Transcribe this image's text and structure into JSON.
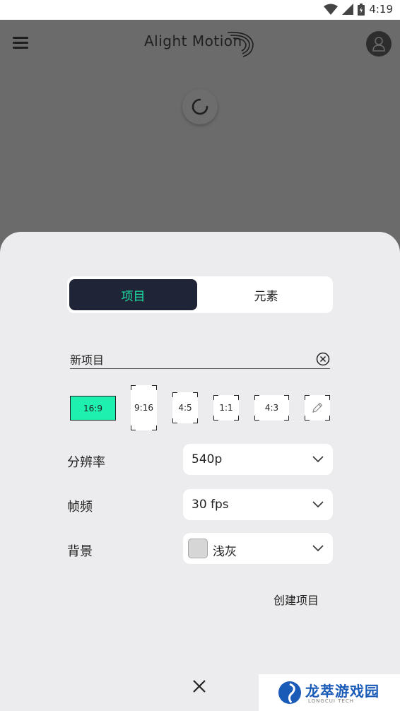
{
  "status_bar": {
    "time": "4:19"
  },
  "app_bar": {
    "logo_text": "Alight Motion"
  },
  "tabs": [
    {
      "label": "项目",
      "active": true
    },
    {
      "label": "元素",
      "active": false
    }
  ],
  "project_name": {
    "value": "新项目"
  },
  "aspect_ratios": [
    {
      "label": "16:9",
      "selected": true
    },
    {
      "label": "9:16",
      "selected": false
    },
    {
      "label": "4:5",
      "selected": false
    },
    {
      "label": "1:1",
      "selected": false
    },
    {
      "label": "4:3",
      "selected": false
    },
    {
      "label": "",
      "icon": "pencil-icon",
      "selected": false
    }
  ],
  "settings": {
    "resolution": {
      "label": "分辨率",
      "value": "540p"
    },
    "frame_rate": {
      "label": "帧频",
      "value": "30 fps"
    },
    "background": {
      "label": "背景",
      "value": "浅灰",
      "swatch_color": "#d6d6d6"
    }
  },
  "actions": {
    "create_label": "创建项目"
  },
  "watermark": {
    "title": "龙萃游戏园",
    "subtitle": "LONGCUI TECH"
  },
  "colors": {
    "accent": "#1ef0b0",
    "dark_tab": "#1f2436",
    "tab_text": "#1ee3a7",
    "sheet_bg": "#ececee"
  }
}
